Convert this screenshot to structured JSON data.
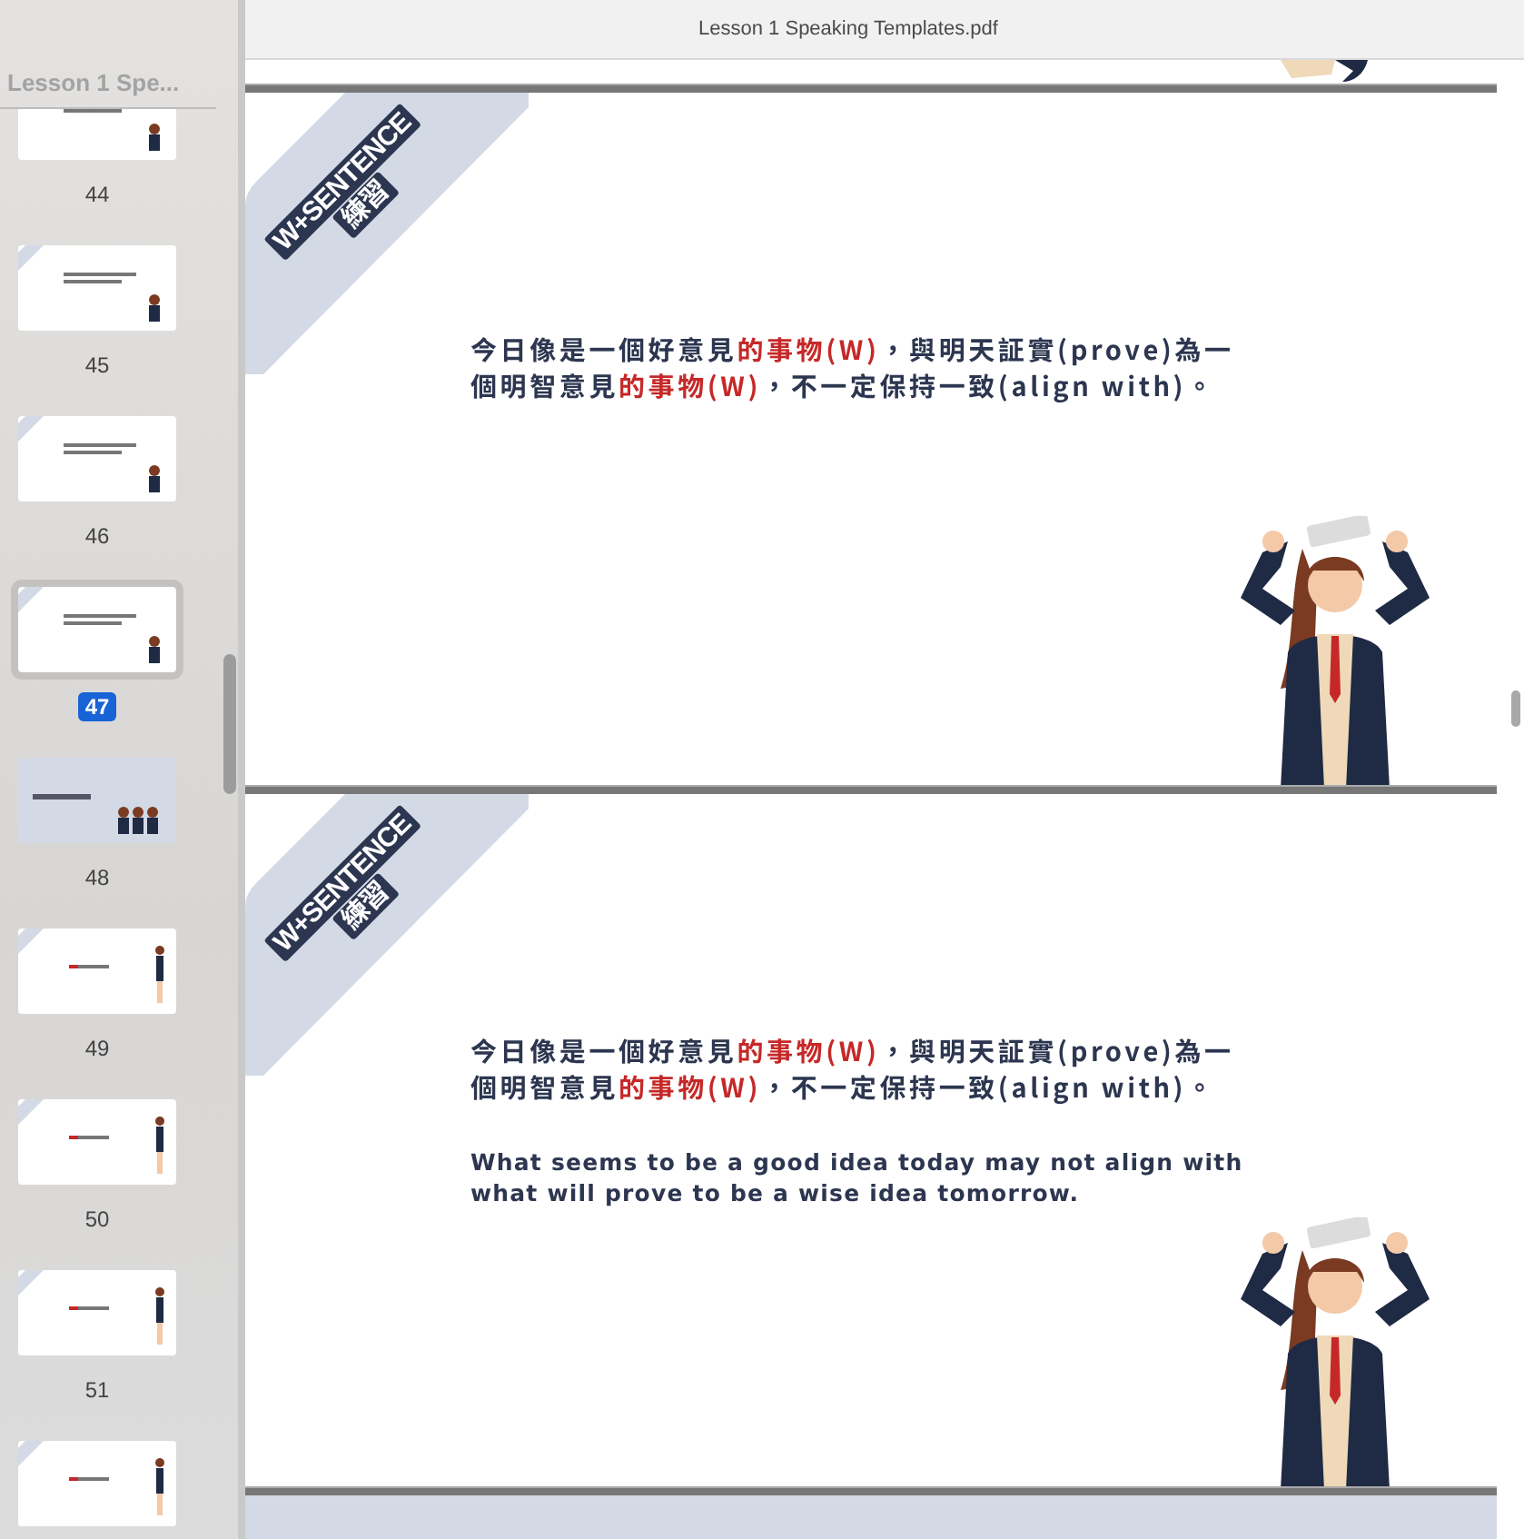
{
  "window": {
    "title": "Lesson 1 Speaking Templates.pdf"
  },
  "sidebar": {
    "title": "Lesson 1 Spe...",
    "thumbnails": [
      {
        "page": "44",
        "kind": "text-slide",
        "selected": false
      },
      {
        "page": "45",
        "kind": "text-slide",
        "selected": false
      },
      {
        "page": "46",
        "kind": "text-slide",
        "selected": false
      },
      {
        "page": "47",
        "kind": "text-slide",
        "selected": true
      },
      {
        "page": "48",
        "kind": "cover",
        "selected": false
      },
      {
        "page": "49",
        "kind": "standing",
        "selected": false
      },
      {
        "page": "50",
        "kind": "standing",
        "selected": false
      },
      {
        "page": "51",
        "kind": "standing",
        "selected": false
      },
      {
        "kind": "standing",
        "selected": false
      }
    ]
  },
  "pages": [
    {
      "kind": "partial"
    },
    {
      "kind": "practice",
      "ribbon": [
        "W+SENTENCE",
        "練習"
      ],
      "chinese": [
        [
          {
            "text": "今日像是一個好意見",
            "highlight": false
          },
          {
            "text": "的事物(W)",
            "highlight": true
          },
          {
            "text": "，與明天証實(prove)為一",
            "highlight": false
          }
        ],
        [
          {
            "text": "個明智意見",
            "highlight": false
          },
          {
            "text": "的事物(W)",
            "highlight": true
          },
          {
            "text": "，不一定保持一致(align with)。",
            "highlight": false
          }
        ]
      ]
    },
    {
      "kind": "practice",
      "ribbon": [
        "W+SENTENCE",
        "練習"
      ],
      "chinese": [
        [
          {
            "text": "今日像是一個好意見",
            "highlight": false
          },
          {
            "text": "的事物(W)",
            "highlight": true
          },
          {
            "text": "，與明天証實(prove)為一",
            "highlight": false
          }
        ],
        [
          {
            "text": "個明智意見",
            "highlight": false
          },
          {
            "text": "的事物(W)",
            "highlight": true
          },
          {
            "text": "，不一定保持一致(align with)。",
            "highlight": false
          }
        ]
      ],
      "english": [
        "What seems to be a good idea today may not align with",
        "what will prove to be a wise idea tomorrow."
      ]
    },
    {
      "kind": "cover"
    }
  ]
}
